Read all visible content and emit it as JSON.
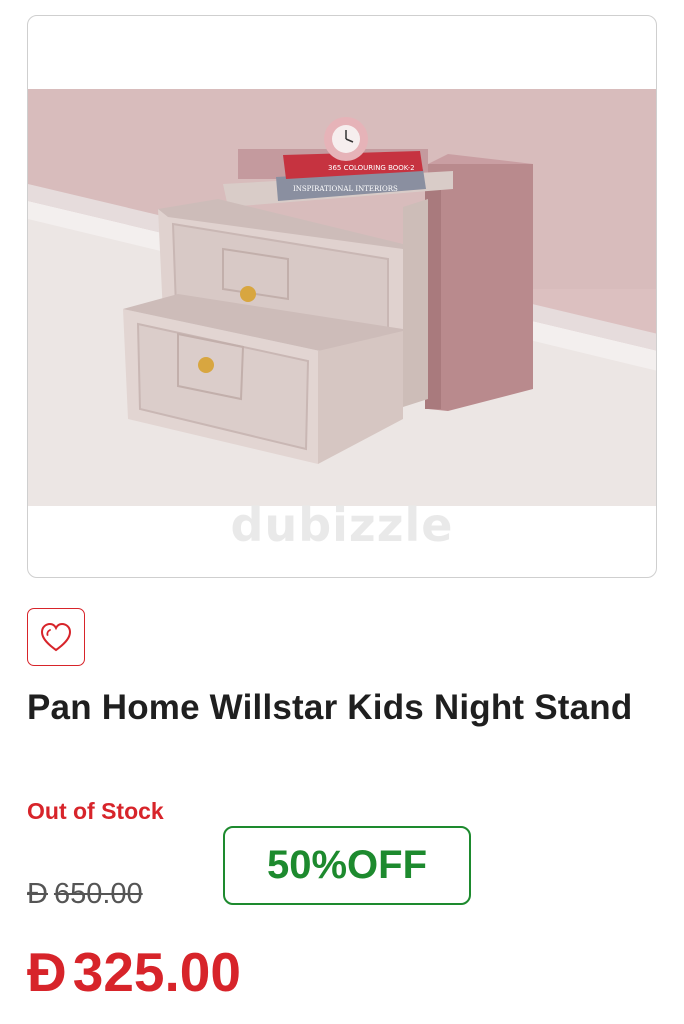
{
  "image": {
    "watermark": "dubizzle",
    "book_top_title": "365 COLOURING BOOK-2",
    "book_bottom_title": "INSPIRATIONAL INTERIORS"
  },
  "wishlist": {
    "icon": "heart-icon"
  },
  "product": {
    "title": "Pan Home Willstar Kids Night Stand",
    "stock_status": "Out of Stock",
    "discount": "50%OFF",
    "currency_symbol": "Đ",
    "old_price": "650.00",
    "new_price": "325.00"
  },
  "colors": {
    "sale_red": "#d7242a",
    "discount_green": "#1d8a2e"
  }
}
